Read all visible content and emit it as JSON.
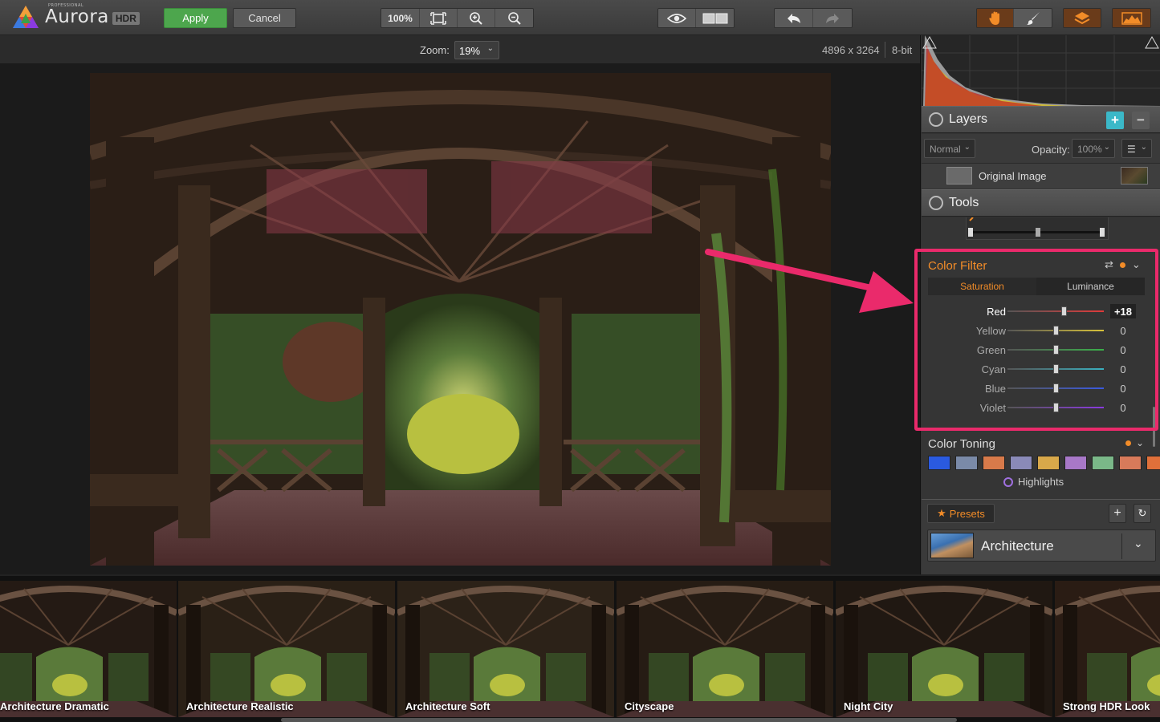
{
  "app": {
    "logo_text": "Aurora",
    "logo_badge": "HDR",
    "logo_super": "PROFESSIONAL"
  },
  "toolbar": {
    "apply_label": "Apply",
    "cancel_label": "Cancel",
    "zoom_100_label": "100%"
  },
  "zoombar": {
    "zoom_label": "Zoom:",
    "zoom_value": "19%",
    "dimensions": "4896 x 3264",
    "bit_depth": "8-bit"
  },
  "layers": {
    "title": "Layers",
    "blend_mode": "Normal",
    "opacity_label": "Opacity:",
    "opacity_value": "100%",
    "layer_name": "Original Image"
  },
  "tools": {
    "title": "Tools"
  },
  "color_filter": {
    "title": "Color Filter",
    "tabs": [
      "Saturation",
      "Luminance"
    ],
    "active_tab": "Saturation",
    "rows": [
      {
        "label": "Red",
        "value": "+18",
        "level": 18,
        "color": "#e03a3a"
      },
      {
        "label": "Yellow",
        "value": "0",
        "level": 0,
        "color": "#d8c23a"
      },
      {
        "label": "Green",
        "value": "0",
        "level": 0,
        "color": "#3ab04a"
      },
      {
        "label": "Cyan",
        "value": "0",
        "level": 0,
        "color": "#3ab0c0"
      },
      {
        "label": "Blue",
        "value": "0",
        "level": 0,
        "color": "#3a5ae0"
      },
      {
        "label": "Violet",
        "value": "0",
        "level": 0,
        "color": "#8a3ae0"
      }
    ]
  },
  "color_toning": {
    "title": "Color Toning",
    "swatches": [
      "#2a5ae0",
      "#7a8aa8",
      "#d87a4a",
      "#8a8ab8",
      "#d8a84a",
      "#a878c8",
      "#7ab888",
      "#d87a5a",
      "#e0703a"
    ],
    "highlights_label": "Highlights"
  },
  "presets": {
    "presets_label": "Presets",
    "category": "Architecture",
    "items": [
      "Architecture Dramatic",
      "Architecture Realistic",
      "Architecture Soft",
      "Cityscape",
      "Night City",
      "Strong HDR Look"
    ]
  },
  "colors": {
    "accent_orange": "#f28c28",
    "apply_green": "#4da64d",
    "annotation_pink": "#ea2a6b"
  }
}
